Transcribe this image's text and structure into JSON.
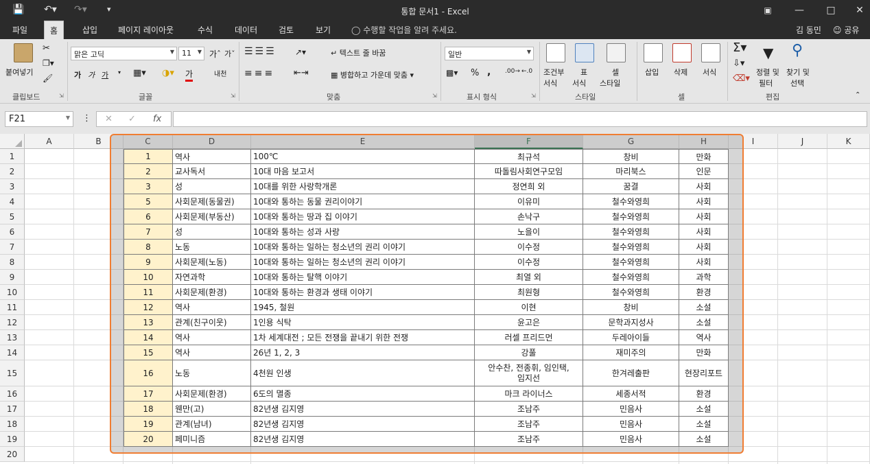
{
  "window": {
    "title": "통합 문서1 - Excel",
    "user": "김 동민",
    "share": "공유"
  },
  "tabs": [
    "파일",
    "홈",
    "삽입",
    "페이지 레이아웃",
    "수식",
    "데이터",
    "검토",
    "보기"
  ],
  "tell_me": "수행할 작업을 알려 주세요.",
  "ribbon": {
    "paste": "붙여넣기",
    "clipboard": "클립보드",
    "font_name": "맑은 고딕",
    "font_size": "11",
    "font": "글꼴",
    "wrap_text": "텍스트 줄 바꿈",
    "merge_center": "병합하고 가운데 맞춤",
    "alignment": "맞춤",
    "number_format": "일반",
    "number": "표시 형식",
    "conditional": "조건부",
    "conditional2": "서식",
    "table": "표",
    "table2": "서식",
    "cell_style": "셀",
    "cell_style2": "스타일",
    "styles": "스타일",
    "insert": "삽입",
    "delete": "삭제",
    "format": "서식",
    "cells": "셀",
    "sort_filter": "정렬 및",
    "sort_filter2": "필터",
    "find_select": "찾기 및",
    "find_select2": "선택",
    "editing": "편집",
    "bold": "가",
    "italic": "가",
    "underline": "가",
    "font_color": "가",
    "phonetic": "내천"
  },
  "formula_bar": {
    "name_box": "F21",
    "fx": "fx",
    "value": ""
  },
  "sheet": {
    "columns": [
      "A",
      "B",
      "C",
      "D",
      "E",
      "F",
      "G",
      "H",
      "I",
      "J",
      "K"
    ],
    "rows": [
      "1",
      "2",
      "3",
      "4",
      "5",
      "6",
      "7",
      "8",
      "9",
      "10",
      "11",
      "12",
      "13",
      "14",
      "15",
      "16",
      "17",
      "18",
      "19",
      "20"
    ],
    "data": [
      [
        "1",
        "역사",
        "100℃",
        "최규석",
        "창비",
        "만화"
      ],
      [
        "2",
        "교사독서",
        "10대 마음 보고서",
        "따돌림사회연구모임",
        "마리북스",
        "인문"
      ],
      [
        "3",
        "성",
        "10대를 위한 사랑학개론",
        "정연희 외",
        "꿈결",
        "사회"
      ],
      [
        "5",
        "사회문제(동물권)",
        "10대와 통하는 동물 권리이야기",
        "이유미",
        "철수와영희",
        "사회"
      ],
      [
        "6",
        "사회문제(부동산)",
        "10대와 통하는 땅과 집 이야기",
        "손낙구",
        "철수와영희",
        "사회"
      ],
      [
        "7",
        "성",
        "10대와 통하는 성과 사랑",
        "노을이",
        "철수와영희",
        "사회"
      ],
      [
        "8",
        "노동",
        "10대와 통하는 일하는 청소년의 권리 이야기",
        "이수정",
        "철수와영희",
        "사회"
      ],
      [
        "9",
        "사회문제(노동)",
        "10대와 통하는 일하는 청소년의 권리 이야기",
        "이수정",
        "철수와영희",
        "사회"
      ],
      [
        "10",
        "자연과학",
        "10대와 통하는 탈핵 이야기",
        "최열 외",
        "철수와영희",
        "과학"
      ],
      [
        "11",
        "사회문제(환경)",
        "10대와 통하는 환경과 생태 이야기",
        "최원형",
        "철수와영희",
        "환경"
      ],
      [
        "12",
        "역사",
        "1945, 철원",
        "이현",
        "창비",
        "소설"
      ],
      [
        "13",
        "관계(친구이웃)",
        "1인용 식탁",
        "윤고은",
        "문학과지성사",
        "소설"
      ],
      [
        "14",
        "역사",
        "1차 세계대전 ; 모든 전쟁을 끝내기 위한 전쟁",
        "러셀 프리드먼",
        "두레아이들",
        "역사"
      ],
      [
        "15",
        "역사",
        "26년 1, 2, 3",
        "강풀",
        "재미주의",
        "만화"
      ],
      [
        "16",
        "노동",
        "4천원 인생",
        "안수찬, 전종휘, 임인택, 임지선",
        "한겨레출판",
        "현장리포트"
      ],
      [
        "17",
        "사회문제(환경)",
        "6도의 멸종",
        "마크 라이너스",
        "세종서적",
        "환경"
      ],
      [
        "18",
        "웬만(고)",
        "82년생 김지영",
        "조남주",
        "민음사",
        "소설"
      ],
      [
        "19",
        "관계(남녀)",
        "82년생 김지영",
        "조남주",
        "민음사",
        "소설"
      ],
      [
        "20",
        "페미니즘",
        "82년생 김지영",
        "조남주",
        "민음사",
        "소설"
      ]
    ],
    "author_multiline": [
      "안수찬, 전종휘, 임인택,",
      "임지선"
    ]
  },
  "colors": {
    "excel_green": "#217346",
    "dark_chrome": "#2b2b2b",
    "highlight_border": "#f07d32",
    "number_cell_fill": "#fff2cc"
  }
}
